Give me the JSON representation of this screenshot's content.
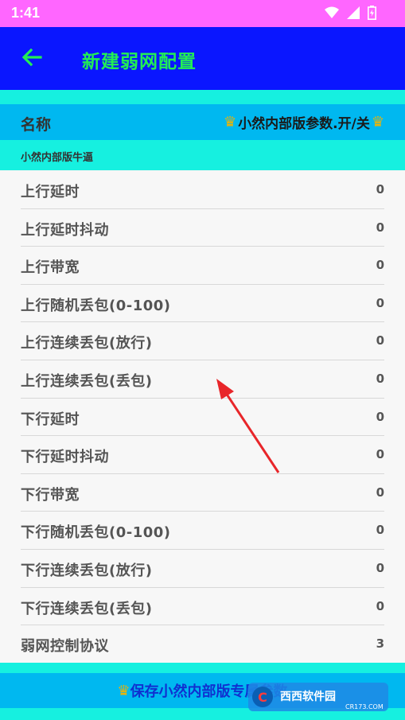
{
  "status_bar": {
    "time": "1:41"
  },
  "app_bar": {
    "title": "新建弱网配置"
  },
  "name_row": {
    "label": "名称",
    "value": "小然内部版参数.开/关"
  },
  "section": {
    "label": "小然内部版牛逼"
  },
  "settings": [
    {
      "label": "上行延时",
      "value": "0"
    },
    {
      "label": "上行延时抖动",
      "value": "0"
    },
    {
      "label": "上行带宽",
      "value": "0"
    },
    {
      "label": "上行随机丢包(0-100)",
      "value": "0"
    },
    {
      "label": "上行连续丢包(放行)",
      "value": "0"
    },
    {
      "label": "上行连续丢包(丢包)",
      "value": "0"
    },
    {
      "label": "下行延时",
      "value": "0"
    },
    {
      "label": "下行延时抖动",
      "value": "0"
    },
    {
      "label": "下行带宽",
      "value": "0"
    },
    {
      "label": "下行随机丢包(0-100)",
      "value": "0"
    },
    {
      "label": "下行连续丢包(放行)",
      "value": "0"
    },
    {
      "label": "下行连续丢包(丢包)",
      "value": "0"
    },
    {
      "label": "弱网控制协议",
      "value": "3"
    }
  ],
  "save_button": {
    "label": "保存小然内部版专属参数"
  },
  "watermark": {
    "brand": "西西软件园",
    "site": "CR173.COM"
  },
  "colors": {
    "status_bar": "#ff66ff",
    "app_bar": "#0a16ff",
    "title": "#22ee55",
    "strip": "#16f0e0",
    "name_row": "#00b8f0"
  }
}
